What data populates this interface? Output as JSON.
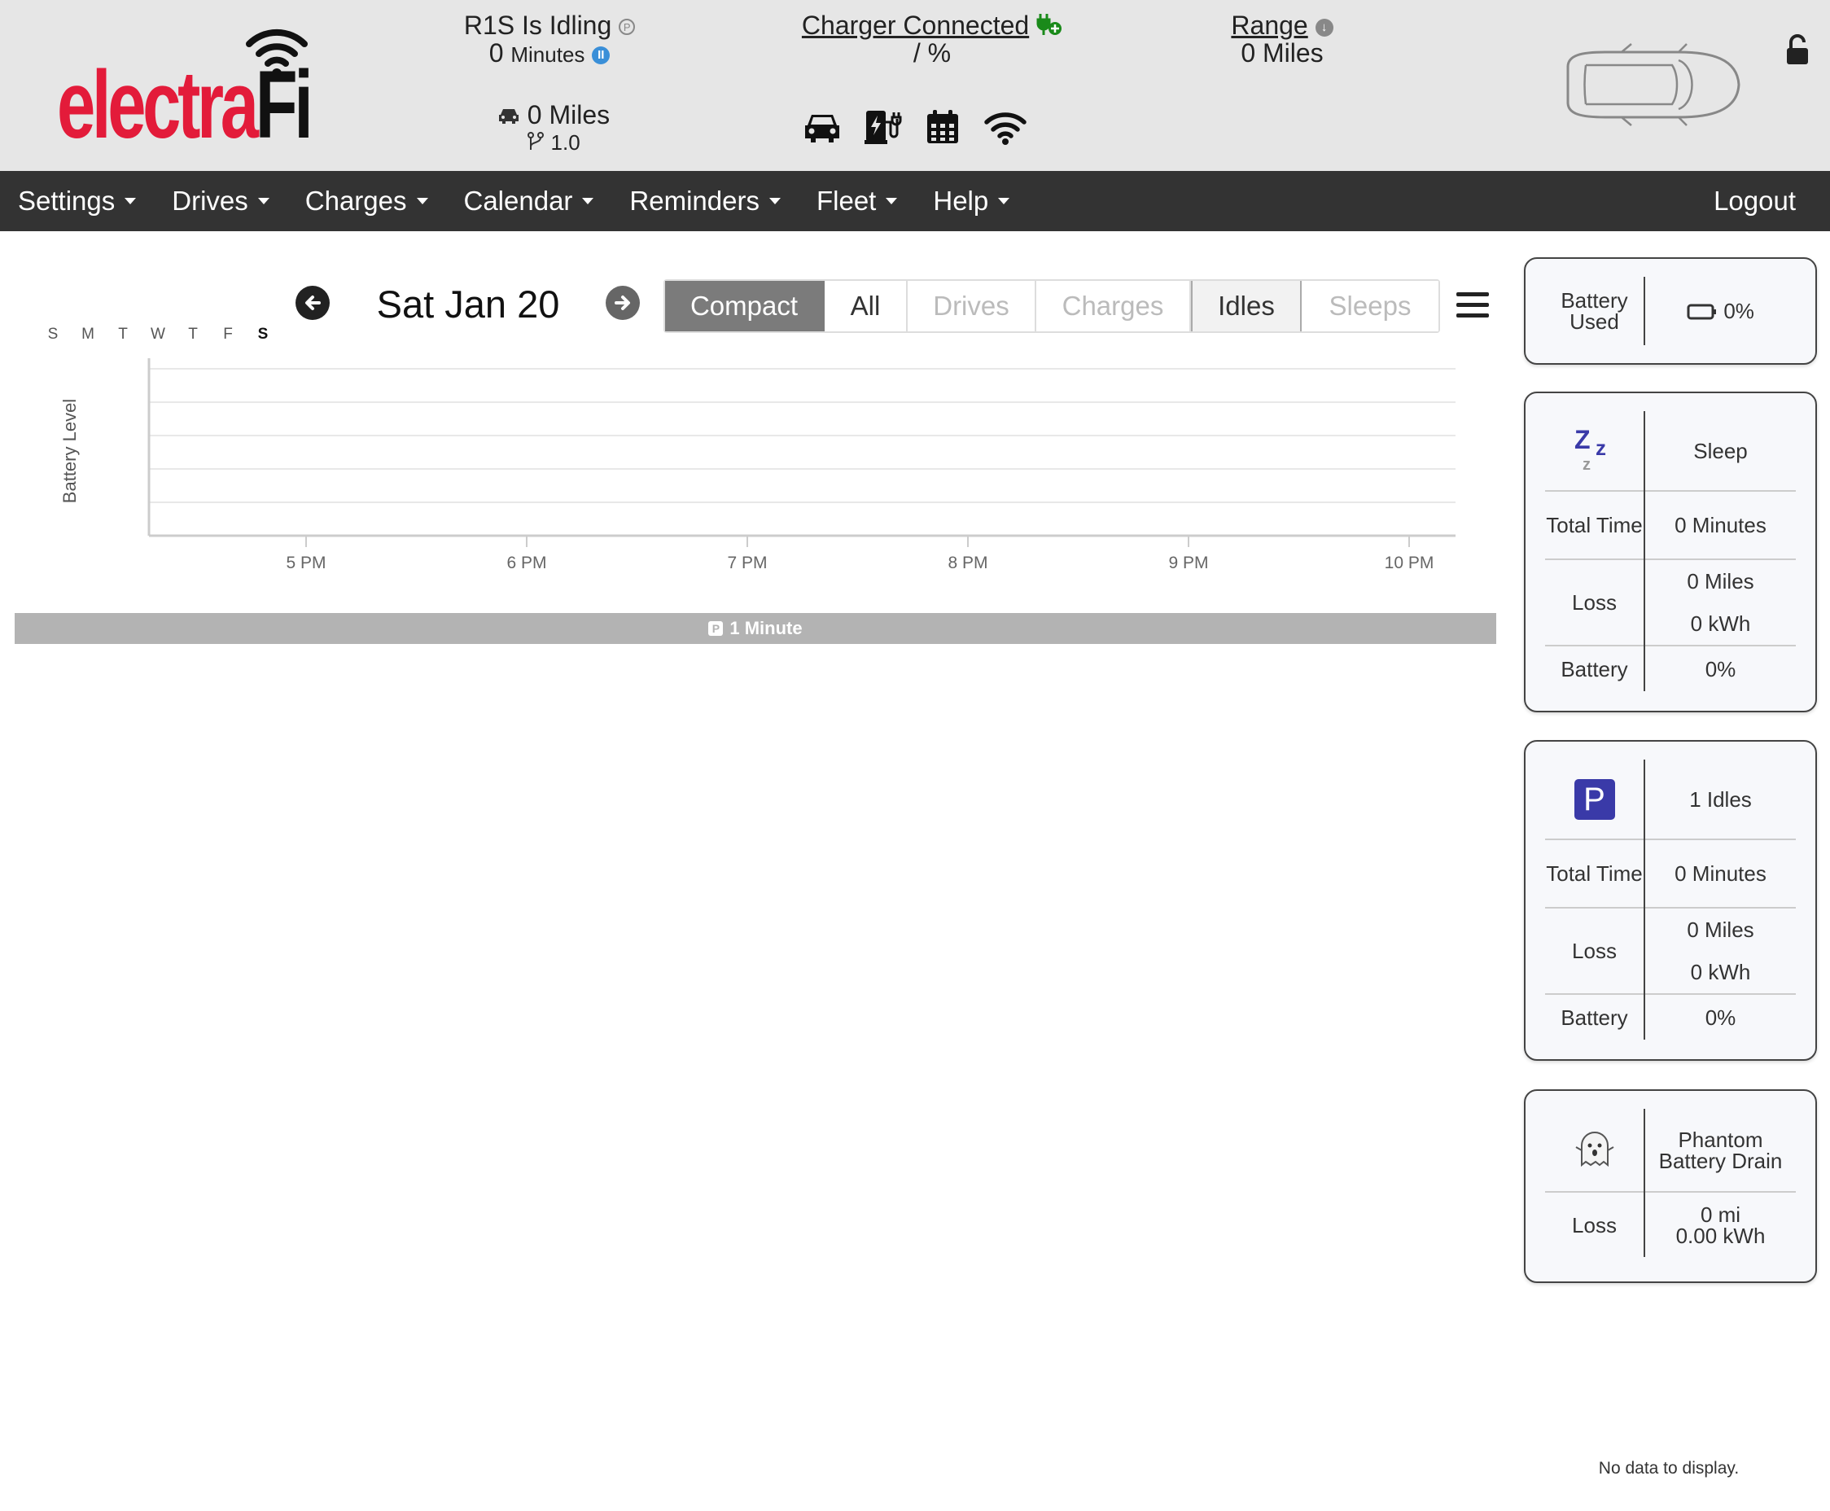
{
  "header": {
    "logo": {
      "part1": "electra",
      "part2": "Fi"
    },
    "idle": {
      "title": "R1S Is Idling",
      "duration_value": "0",
      "duration_unit": "Minutes"
    },
    "charger": {
      "title": "Charger Connected",
      "level": "/ %"
    },
    "range": {
      "title": "Range",
      "value": "0 Miles"
    },
    "trip": {
      "miles": "0 Miles",
      "version": "1.0"
    },
    "icons": [
      "car-icon",
      "charging-station-icon",
      "calendar-icon",
      "wifi-icon"
    ],
    "colors": {
      "accent_green": "#1a8a1a",
      "info_blue": "#3a8fd8",
      "logo_red": "#e31b3a"
    }
  },
  "nav": {
    "items": [
      {
        "label": "Settings"
      },
      {
        "label": "Drives"
      },
      {
        "label": "Charges"
      },
      {
        "label": "Calendar"
      },
      {
        "label": "Reminders"
      },
      {
        "label": "Fleet"
      },
      {
        "label": "Help"
      }
    ],
    "logout": "Logout"
  },
  "week": {
    "days": [
      "S",
      "M",
      "T",
      "W",
      "T",
      "F",
      "S"
    ],
    "active_index": 6
  },
  "date": {
    "title": "Sat Jan 20"
  },
  "filters": {
    "compact": "Compact",
    "all": "All",
    "drives": "Drives",
    "charges": "Charges",
    "idles": "Idles",
    "sleeps": "Sleeps",
    "selected": [
      "Compact",
      "Idles"
    ]
  },
  "chart_data": {
    "type": "line",
    "ylabel": "Battery Level",
    "xlabel": "",
    "x_ticks": [
      "5 PM",
      "6 PM",
      "7 PM",
      "8 PM",
      "9 PM",
      "10 PM"
    ],
    "series": [],
    "grid": true
  },
  "timeline": {
    "label": "1 Minute"
  },
  "cards": {
    "battery": {
      "label": "Battery Used",
      "value": "0%"
    },
    "sleep": {
      "title": "Sleep",
      "total_time_label": "Total Time",
      "total_time": "0 Minutes",
      "loss_label": "Loss",
      "loss_miles": "0 Miles",
      "loss_kwh": "0 kWh",
      "battery_label": "Battery",
      "battery": "0%"
    },
    "idle": {
      "title": "1 Idles",
      "total_time_label": "Total Time",
      "total_time": "0 Minutes",
      "loss_label": "Loss",
      "loss_miles": "0 Miles",
      "loss_kwh": "0 kWh",
      "battery_label": "Battery",
      "battery": "0%"
    },
    "phantom": {
      "title": "Phantom Battery Drain",
      "loss_label": "Loss",
      "loss_mi": "0 mi",
      "loss_kwh": "0.00 kWh"
    }
  },
  "footer": {
    "no_data": "No data to display."
  }
}
